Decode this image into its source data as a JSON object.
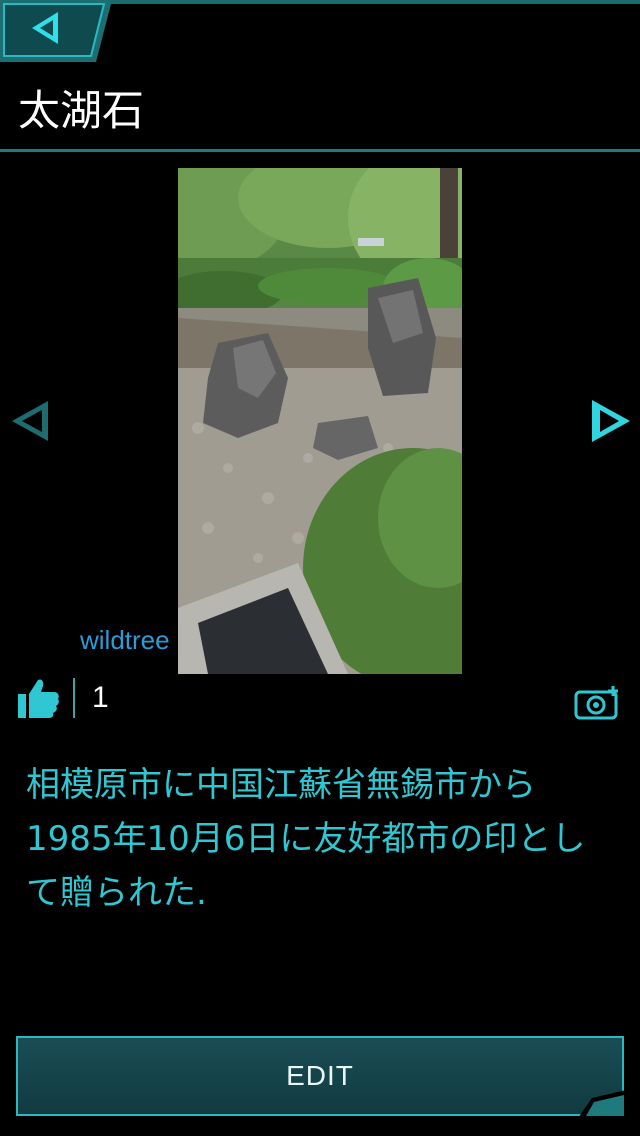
{
  "header": {
    "title": "太湖石"
  },
  "photo": {
    "uploader": "wildtree"
  },
  "likes": {
    "count": "1"
  },
  "description": "相模原市に中国江蘇省無錫市から1985年10月6日に友好都市の印として贈られた.",
  "actions": {
    "edit_label": "EDIT"
  },
  "icons": {
    "back": "back-arrow-icon",
    "prev": "prev-photo-icon",
    "next": "next-photo-icon",
    "like": "thumbs-up-icon",
    "add_photo": "add-photo-camera-icon"
  },
  "colors": {
    "accent": "#2fc8d2",
    "frame": "#1e7a7d",
    "uploader": "#2a9bd8",
    "background": "#000000"
  }
}
